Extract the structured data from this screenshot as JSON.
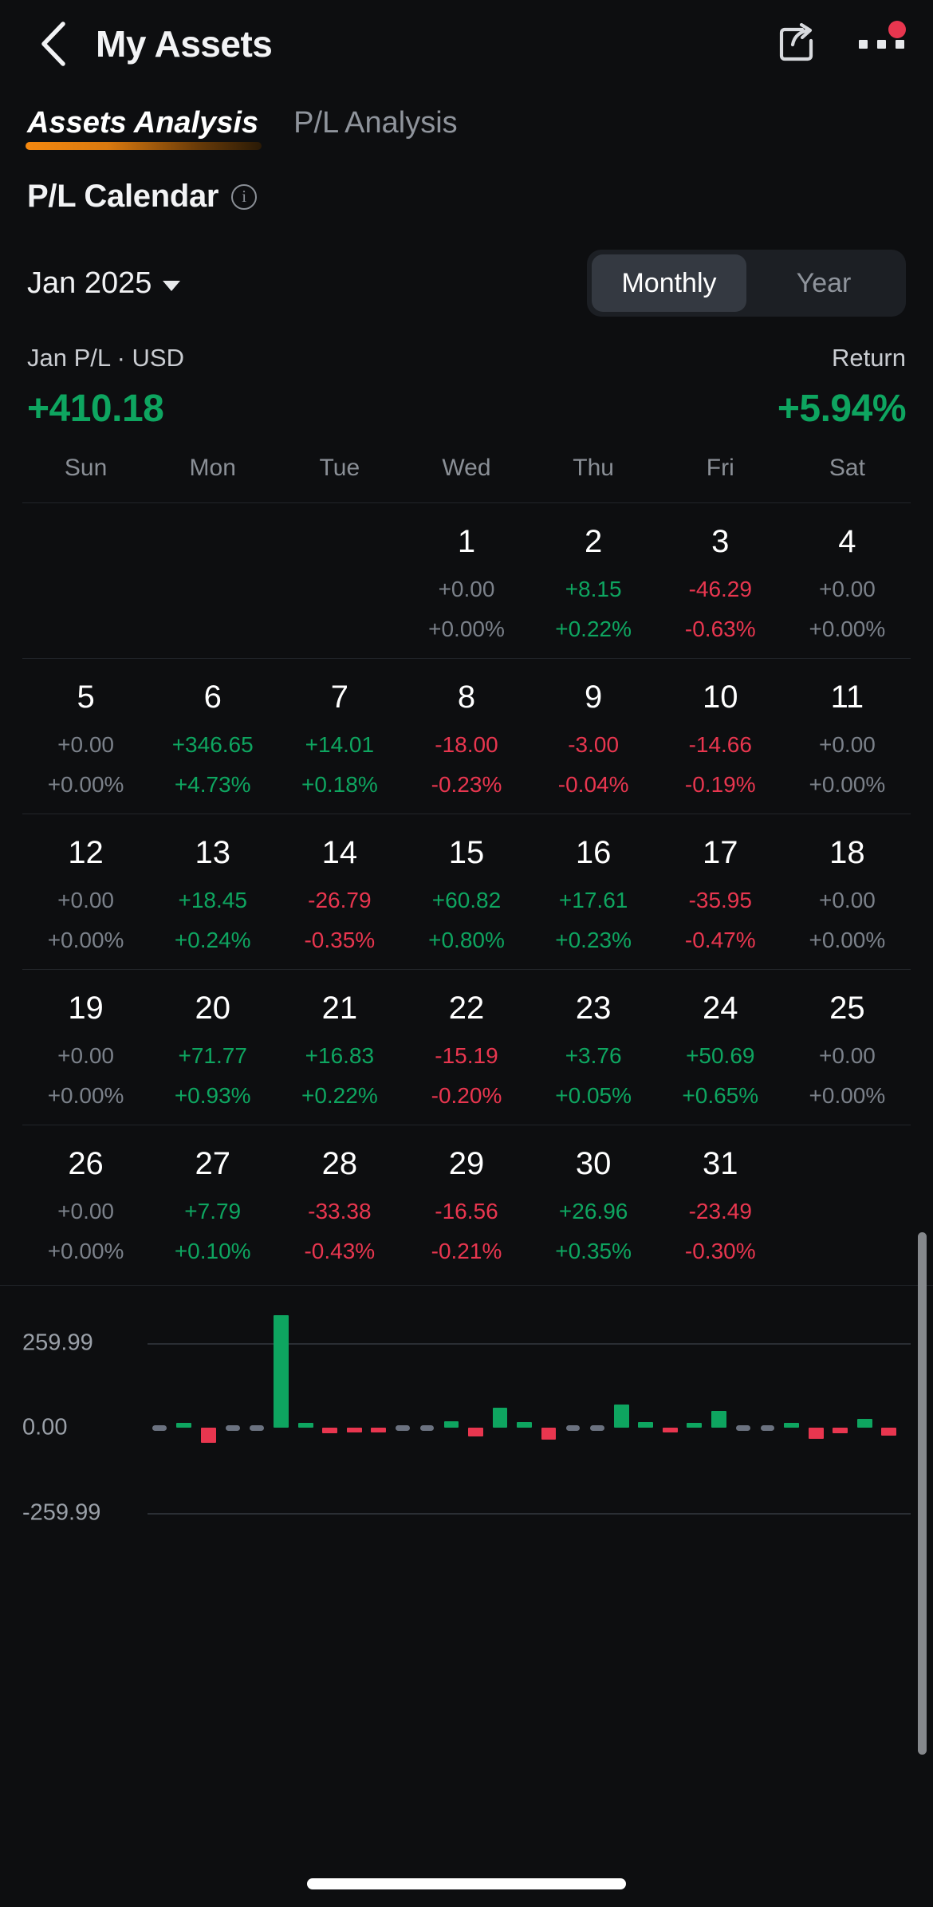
{
  "header": {
    "title": "My Assets",
    "back_icon": "chevron-left-icon",
    "share_icon": "share-icon",
    "more_icon": "more-horizontal-icon",
    "has_notification_badge": true
  },
  "tabs": [
    {
      "label": "Assets Analysis",
      "active": true
    },
    {
      "label": "P/L Analysis",
      "active": false
    }
  ],
  "section": {
    "title": "P/L Calendar",
    "info_icon": "info-circle-icon"
  },
  "controls": {
    "month": "Jan 2025",
    "dropdown_icon": "caret-down-icon",
    "period_options": [
      {
        "label": "Monthly",
        "selected": true
      },
      {
        "label": "Year",
        "selected": false
      }
    ]
  },
  "summary": {
    "pl_label": "Jan P/L · USD",
    "pl_value": "+410.18",
    "return_label": "Return",
    "return_value": "+5.94%"
  },
  "colors": {
    "positive": "#0ea560",
    "negative": "#e8364f",
    "neutral": "#7b818a",
    "accent": "#f5880f",
    "background": "#0d0e10"
  },
  "calendar": {
    "weekdays": [
      "Sun",
      "Mon",
      "Tue",
      "Wed",
      "Thu",
      "Fri",
      "Sat"
    ],
    "leading_blanks": 3,
    "days": [
      {
        "day": "1",
        "value": "+0.00",
        "percent": "+0.00%",
        "sign": "zero"
      },
      {
        "day": "2",
        "value": "+8.15",
        "percent": "+0.22%",
        "sign": "pos"
      },
      {
        "day": "3",
        "value": "-46.29",
        "percent": "-0.63%",
        "sign": "neg"
      },
      {
        "day": "4",
        "value": "+0.00",
        "percent": "+0.00%",
        "sign": "zero"
      },
      {
        "day": "5",
        "value": "+0.00",
        "percent": "+0.00%",
        "sign": "zero"
      },
      {
        "day": "6",
        "value": "+346.65",
        "percent": "+4.73%",
        "sign": "pos"
      },
      {
        "day": "7",
        "value": "+14.01",
        "percent": "+0.18%",
        "sign": "pos"
      },
      {
        "day": "8",
        "value": "-18.00",
        "percent": "-0.23%",
        "sign": "neg"
      },
      {
        "day": "9",
        "value": "-3.00",
        "percent": "-0.04%",
        "sign": "neg"
      },
      {
        "day": "10",
        "value": "-14.66",
        "percent": "-0.19%",
        "sign": "neg"
      },
      {
        "day": "11",
        "value": "+0.00",
        "percent": "+0.00%",
        "sign": "zero"
      },
      {
        "day": "12",
        "value": "+0.00",
        "percent": "+0.00%",
        "sign": "zero"
      },
      {
        "day": "13",
        "value": "+18.45",
        "percent": "+0.24%",
        "sign": "pos"
      },
      {
        "day": "14",
        "value": "-26.79",
        "percent": "-0.35%",
        "sign": "neg"
      },
      {
        "day": "15",
        "value": "+60.82",
        "percent": "+0.80%",
        "sign": "pos"
      },
      {
        "day": "16",
        "value": "+17.61",
        "percent": "+0.23%",
        "sign": "pos"
      },
      {
        "day": "17",
        "value": "-35.95",
        "percent": "-0.47%",
        "sign": "neg"
      },
      {
        "day": "18",
        "value": "+0.00",
        "percent": "+0.00%",
        "sign": "zero"
      },
      {
        "day": "19",
        "value": "+0.00",
        "percent": "+0.00%",
        "sign": "zero"
      },
      {
        "day": "20",
        "value": "+71.77",
        "percent": "+0.93%",
        "sign": "pos"
      },
      {
        "day": "21",
        "value": "+16.83",
        "percent": "+0.22%",
        "sign": "pos"
      },
      {
        "day": "22",
        "value": "-15.19",
        "percent": "-0.20%",
        "sign": "neg"
      },
      {
        "day": "23",
        "value": "+3.76",
        "percent": "+0.05%",
        "sign": "pos"
      },
      {
        "day": "24",
        "value": "+50.69",
        "percent": "+0.65%",
        "sign": "pos"
      },
      {
        "day": "25",
        "value": "+0.00",
        "percent": "+0.00%",
        "sign": "zero"
      },
      {
        "day": "26",
        "value": "+0.00",
        "percent": "+0.00%",
        "sign": "zero"
      },
      {
        "day": "27",
        "value": "+7.79",
        "percent": "+0.10%",
        "sign": "pos"
      },
      {
        "day": "28",
        "value": "-33.38",
        "percent": "-0.43%",
        "sign": "neg"
      },
      {
        "day": "29",
        "value": "-16.56",
        "percent": "-0.21%",
        "sign": "neg"
      },
      {
        "day": "30",
        "value": "+26.96",
        "percent": "+0.35%",
        "sign": "pos"
      },
      {
        "day": "31",
        "value": "-23.49",
        "percent": "-0.30%",
        "sign": "neg"
      }
    ]
  },
  "chart_data": {
    "type": "bar",
    "title": "",
    "xlabel": "",
    "ylabel": "",
    "ylim": [
      -259.99,
      259.99
    ],
    "yticks": [
      "259.99",
      "0.00",
      "-259.99"
    ],
    "grid": true,
    "legend": "none",
    "categories": [
      "1",
      "2",
      "3",
      "4",
      "5",
      "6",
      "7",
      "8",
      "9",
      "10",
      "11",
      "12",
      "13",
      "14",
      "15",
      "16",
      "17",
      "18",
      "19",
      "20",
      "21",
      "22",
      "23",
      "24",
      "25",
      "26",
      "27",
      "28",
      "29",
      "30",
      "31"
    ],
    "values": [
      0.0,
      8.15,
      -46.29,
      0.0,
      0.0,
      346.65,
      14.01,
      -18.0,
      -3.0,
      -14.66,
      0.0,
      0.0,
      18.45,
      -26.79,
      60.82,
      17.61,
      -35.95,
      0.0,
      0.0,
      71.77,
      16.83,
      -15.19,
      3.76,
      50.69,
      0.0,
      0.0,
      7.79,
      -33.38,
      -16.56,
      26.96,
      -23.49
    ],
    "positive_color": "#0ea560",
    "negative_color": "#e8364f",
    "zero_color": "#6b7280"
  }
}
